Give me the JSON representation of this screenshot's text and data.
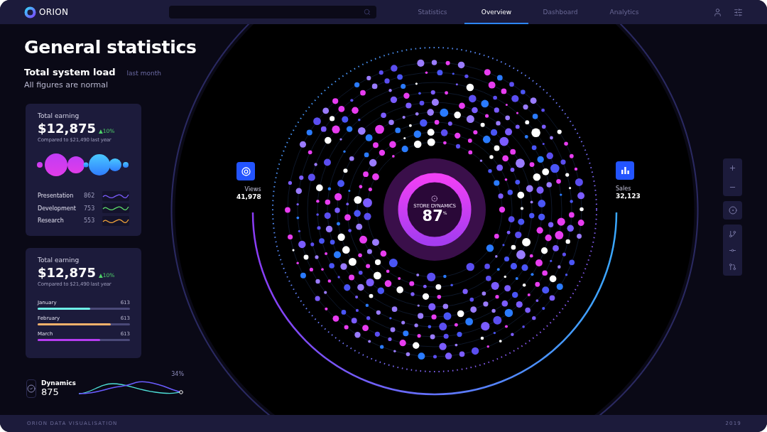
{
  "app": {
    "logo": "ORION"
  },
  "tabs": [
    {
      "label": "Statistics",
      "selected": false
    },
    {
      "label": "Overview",
      "selected": true
    },
    {
      "label": "Dashboard",
      "selected": false
    },
    {
      "label": "Analytics",
      "selected": false
    }
  ],
  "page": {
    "title": "General statistics",
    "subtitle": "Total system load",
    "period": "last month",
    "status": "All figures are normal"
  },
  "cards": [
    {
      "kind": "bubbles",
      "label": "Total earning",
      "amount": "$12,875",
      "change": "▲10%",
      "comparison": "Compared to $21,490 last year",
      "rows": [
        {
          "name": "Presentation",
          "value": "862",
          "color": "#7b5cff"
        },
        {
          "name": "Development",
          "value": "753",
          "color": "#5ddb6a"
        },
        {
          "name": "Research",
          "value": "553",
          "color": "#f0a23a"
        }
      ]
    },
    {
      "kind": "bars",
      "label": "Total earning",
      "amount": "$12,875",
      "change": "▲10%",
      "comparison": "Compared to $21,490 last year",
      "rows": [
        {
          "name": "January",
          "value": "613",
          "color": "#6ef0e8",
          "level": 0.57
        },
        {
          "name": "February",
          "value": "613",
          "color": "#f6b26b",
          "level": 0.79
        },
        {
          "name": "March",
          "value": "613",
          "color": "#b53cf0",
          "level": 0.68
        }
      ]
    }
  ],
  "views": {
    "label": "Views",
    "value": "41,978"
  },
  "sales": {
    "label": "Sales",
    "value": "32,123"
  },
  "center": {
    "label": "STORE DYNAMICS",
    "value": "87",
    "unit": "%"
  },
  "dynamics": {
    "label": "Dynamics",
    "value": "875",
    "change": "34%"
  },
  "footer": {
    "brand": "ORION DATA VISUALISATION",
    "year": "2019"
  }
}
